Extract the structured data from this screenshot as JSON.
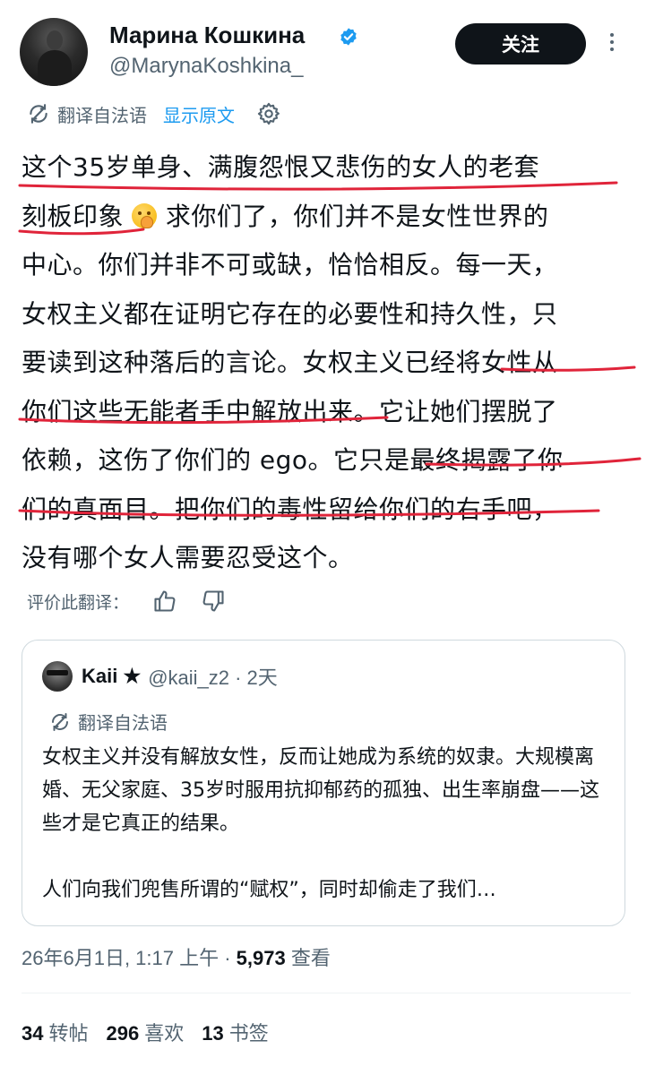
{
  "author": {
    "display_name": "Марина Кошкина",
    "handle": "@MarynaKoshkina_",
    "verified": true
  },
  "actions": {
    "follow_label": "关注",
    "more_icon": "more-vertical-icon"
  },
  "translation": {
    "label": "翻译自法语",
    "show_original": "显示原文",
    "settings_icon": "gear-icon"
  },
  "tweet": {
    "lines": [
      "这个35岁单身、满腹怨恨又悲伤的女人的老套",
      "刻板印象",
      " 求你们了，你们并不是女性世界的",
      "中心。你们并非不可或缺，恰恰相反。每一天，",
      "女权主义都在证明它存在的必要性和持久性，只",
      "要读到这种落后的言论。女权主义已经将女性从",
      "你们这些无能者手中解放出来。它让她们摆脱了",
      "依赖，这伤了你们的 ego。它只是最终揭露了你",
      "们的真面目。把你们的毒性留给你们的右手吧，",
      "没有哪个女人需要忍受这个。"
    ],
    "emoji": "hand-over-mouth-emoji",
    "underline_color": "#e0243a"
  },
  "rate": {
    "label": "评价此翻译：",
    "up_icon": "thumbs-up-icon",
    "down_icon": "thumbs-down-icon"
  },
  "quote": {
    "name": "Kaii ★",
    "handle_time": "@kaii_z2 · 2天",
    "translation_label": "翻译自法语",
    "paragraph1": "女权主义并没有解放女性，反而让她成为系统的奴隶。大规模离婚、无父家庭、35岁时服用抗抑郁药的孤独、出生率崩盘——这些才是它真正的结果。",
    "paragraph2": "人们向我们兜售所谓的“赋权”，同时却偷走了我们…"
  },
  "meta": {
    "timestamp": "26年6月1日, 1:17 上午 · ",
    "views_count": "5,973",
    "views_label": " 查看"
  },
  "stats": {
    "reposts_count": "34",
    "reposts_label": "转帖",
    "likes_count": "296",
    "likes_label": "喜欢",
    "bookmarks_count": "13",
    "bookmarks_label": "书签"
  },
  "colors": {
    "accent": "#1d9bf0",
    "text": "#0f1419",
    "secondary": "#536471",
    "button_bg": "#0f1419"
  }
}
